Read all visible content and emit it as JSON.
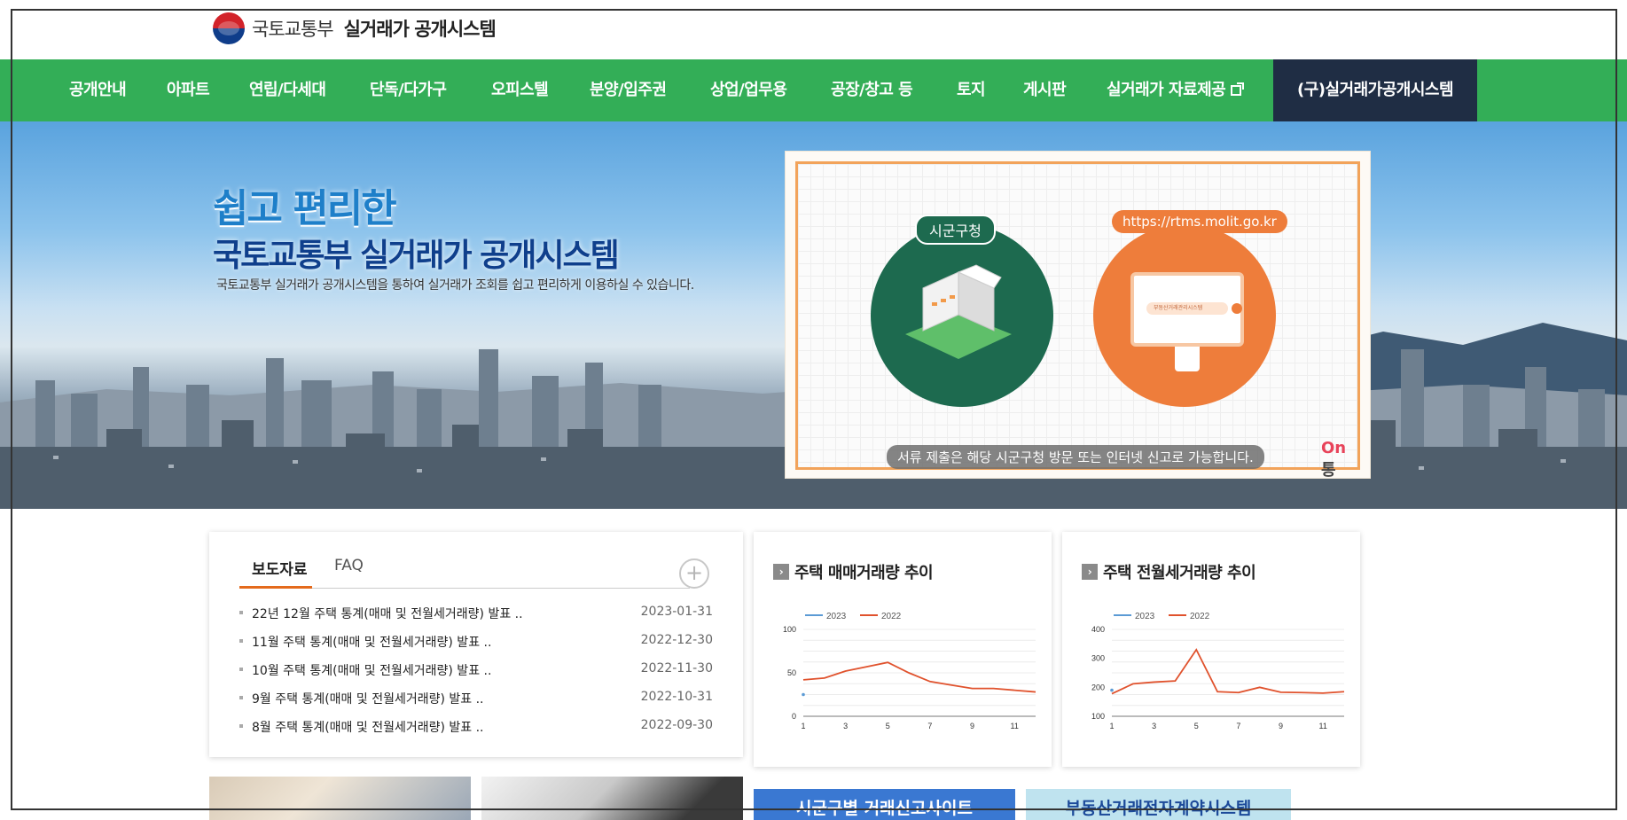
{
  "header": {
    "ministry": "국토교통부",
    "system_name": "실거래가 공개시스템"
  },
  "nav": {
    "items": [
      "공개안내",
      "아파트",
      "연립/다세대",
      "단독/다가구",
      "오피스텔",
      "분양/입주권",
      "상업/업무용",
      "공장/창고 등",
      "토지",
      "게시판",
      "실거래가 자료제공"
    ],
    "old_system": "(구)실거래가공개시스템"
  },
  "hero": {
    "title_line1": "쉽고 편리한",
    "title_line2": "국토교통부 실거래가 공개시스템",
    "subtitle": "국토교통부 실거래가 공개시스템을 통하여 실거래가 조회를 쉽고 편리하게 이용하실 수 있습니다.",
    "video": {
      "label_city": "시군구청",
      "label_url": "https://rtms.molit.go.kr",
      "monitor_search": "부동산거래관리시스템",
      "caption": "서류 제출은 해당 시군구청 방문 또는 인터넷 신고로 가능합니다.",
      "logo_on": "On",
      "logo_tong": "통"
    }
  },
  "press": {
    "tabs": [
      "보도자료",
      "FAQ"
    ],
    "more_label": "+",
    "items": [
      {
        "title": "22년 12월 주택 통계(매매 및 전월세거래량) 발표 ..",
        "date": "2023-01-31"
      },
      {
        "title": "11월 주택 통계(매매 및 전월세거래량) 발표 ..",
        "date": "2022-12-30"
      },
      {
        "title": "10월 주택 통계(매매 및 전월세거래량) 발표 ..",
        "date": "2022-11-30"
      },
      {
        "title": "9월 주택 통계(매매 및 전월세거래량) 발표 ..",
        "date": "2022-10-31"
      },
      {
        "title": "8월 주택 통계(매매 및 전월세거래량) 발표 ..",
        "date": "2022-09-30"
      }
    ]
  },
  "charts": {
    "sale_title": "주택 매매거래량 추이",
    "rent_title": "주택 전월세거래량 추이"
  },
  "colors": {
    "nav_green": "#33ae57",
    "nav_dark": "#1f2d44",
    "series_2023": "#5b9bd5",
    "series_2022": "#e0522d",
    "tab_accent": "#e46a1c"
  },
  "bottom": {
    "banner_1": "시군구별 거래신고사이트",
    "banner_2": "부동산거래전자계약시스템"
  },
  "chart_data": [
    {
      "type": "line",
      "title": "주택 매매거래량 추이",
      "x": [
        1,
        2,
        3,
        4,
        5,
        6,
        7,
        8,
        9,
        10,
        11,
        12
      ],
      "xticks": [
        1,
        3,
        5,
        7,
        9,
        11
      ],
      "yticks": [
        0,
        50,
        100
      ],
      "ylim": [
        0,
        100
      ],
      "legend": "top-left",
      "series": [
        {
          "name": "2023",
          "color": "#5b9bd5",
          "values": [
            25
          ]
        },
        {
          "name": "2022",
          "color": "#e0522d",
          "values": [
            42,
            44,
            52,
            57,
            62,
            50,
            40,
            36,
            32,
            32,
            30,
            28
          ]
        }
      ]
    },
    {
      "type": "line",
      "title": "주택 전월세거래량 추이",
      "x": [
        1,
        2,
        3,
        4,
        5,
        6,
        7,
        8,
        9,
        10,
        11,
        12
      ],
      "xticks": [
        1,
        3,
        5,
        7,
        9,
        11
      ],
      "yticks": [
        100,
        200,
        300,
        400
      ],
      "ylim": [
        100,
        400
      ],
      "legend": "top-left",
      "series": [
        {
          "name": "2023",
          "color": "#5b9bd5",
          "values": [
            190
          ]
        },
        {
          "name": "2022",
          "color": "#e0522d",
          "values": [
            178,
            212,
            218,
            222,
            330,
            185,
            182,
            200,
            183,
            182,
            180,
            185
          ]
        }
      ]
    }
  ]
}
